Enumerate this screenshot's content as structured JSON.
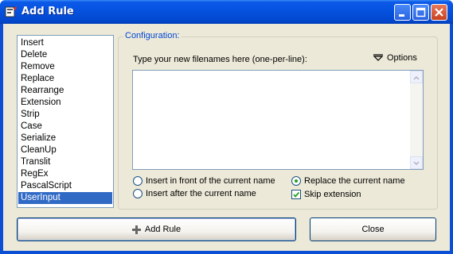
{
  "window": {
    "title": "Add Rule",
    "accent": "#0a4fd4"
  },
  "rules_list": {
    "items": [
      "Insert",
      "Delete",
      "Remove",
      "Replace",
      "Rearrange",
      "Extension",
      "Strip",
      "Case",
      "Serialize",
      "CleanUp",
      "Translit",
      "RegEx",
      "PascalScript",
      "UserInput"
    ],
    "selected": "UserInput"
  },
  "configuration": {
    "legend": "Configuration:",
    "hint": "Type your new filenames here (one-per-line):",
    "options_label": "Options",
    "filenames_value": ""
  },
  "position_options": {
    "insert_front": "Insert in front of the current name",
    "insert_after": "Insert after the current name",
    "replace": "Replace the current name",
    "selected": "replace"
  },
  "skip_extension": {
    "label": "Skip extension",
    "checked": true
  },
  "buttons": {
    "add_rule": "Add Rule",
    "close": "Close"
  }
}
